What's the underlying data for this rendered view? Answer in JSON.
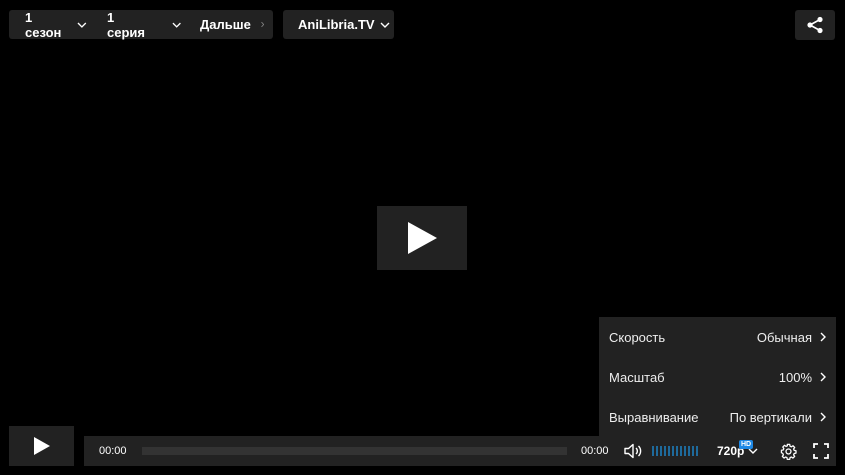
{
  "top_bar": {
    "season_label": "1 сезон",
    "episode_label": "1 серия",
    "next_label": "Дальше",
    "source_label": "AniLibria.TV"
  },
  "settings_menu": {
    "rows": [
      {
        "label": "Скорость",
        "value": "Обычная"
      },
      {
        "label": "Масштаб",
        "value": "100%"
      },
      {
        "label": "Выравнивание",
        "value": "По вертикали"
      }
    ]
  },
  "controls": {
    "current_time": "00:00",
    "duration": "00:00",
    "progress": 0,
    "volume_level": 1.0,
    "quality_label": "720p",
    "quality_badge": "HD"
  },
  "icons": {
    "share": "share-icon",
    "play": "play-icon",
    "volume": "volume-icon",
    "settings": "gear-icon",
    "fullscreen": "fullscreen-icon",
    "chevron": "chevron-down-icon"
  },
  "colors": {
    "background": "#000000",
    "panel": "#222222",
    "volume_bar": "#1e6a9c",
    "hd_badge": "#1e88e5"
  }
}
